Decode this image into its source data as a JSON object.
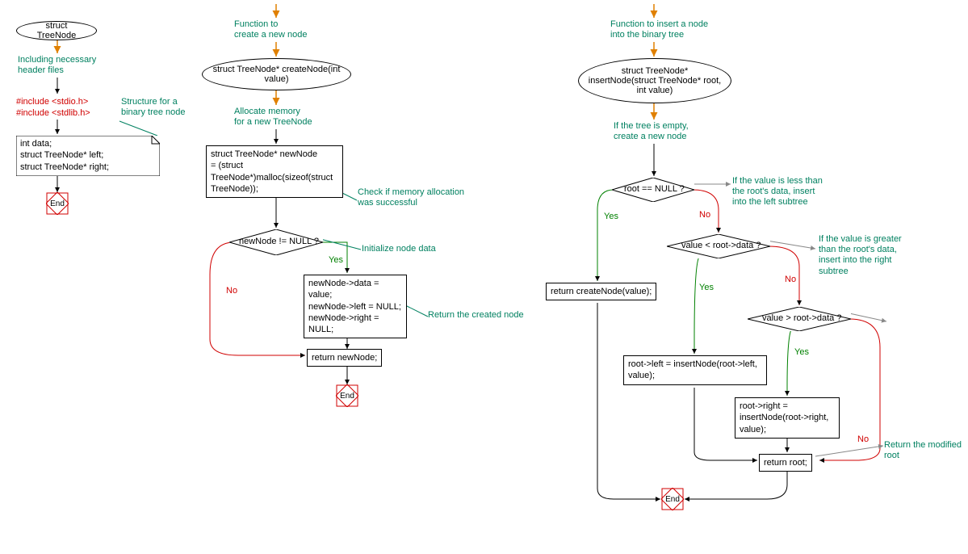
{
  "flow1": {
    "start": "struct TreeNode",
    "comment1": "Including necessary\nheader files",
    "includes": "#include <stdio.h>\n#include <stdlib.h>",
    "comment2": "Structure for a\nbinary tree node",
    "box1": "int data;\nstruct TreeNode* left;\nstruct TreeNode* right;",
    "end": "End"
  },
  "flow2": {
    "comment_top": "Function to\ncreate a new node",
    "start": "struct TreeNode* createNode(int\nvalue)",
    "comment_alloc": "Allocate memory\nfor a new TreeNode",
    "box_alloc": "struct TreeNode* newNode\n= (struct\nTreeNode*)malloc(sizeof(struct\nTreeNode));",
    "comment_check": "Check if memory allocation\nwas successful",
    "decision": "newNode != NULL ?",
    "yes": "Yes",
    "no": "No",
    "comment_init": "Initialize node data",
    "box_init": "newNode->data = value;\nnewNode->left = NULL;\nnewNode->right = NULL;",
    "comment_return": "Return the created node",
    "box_return": "return newNode;",
    "end": "End"
  },
  "flow3": {
    "comment_top": "Function to insert a node\ninto the binary tree",
    "start": "struct TreeNode*\ninsertNode(struct TreeNode*\nroot, int value)",
    "comment_empty": "If the tree is empty,\ncreate a new node",
    "decision1": "root == NULL ?",
    "yes": "Yes",
    "no": "No",
    "comment_less": "If the value is less than\nthe root's data, insert\ninto the left subtree",
    "decision2": "value < root->data ?",
    "comment_greater": "If the value is greater\nthan the root's data,\ninsert into the right\nsubtree",
    "box_create": "return createNode(value);",
    "decision3": "value > root->data ?",
    "box_left": "root->left = insertNode(root->left,\nvalue);",
    "box_right": "root->right =\ninsertNode(root->right,\nvalue);",
    "comment_return": "Return the modified root",
    "box_return": "return root;",
    "end": "End"
  }
}
